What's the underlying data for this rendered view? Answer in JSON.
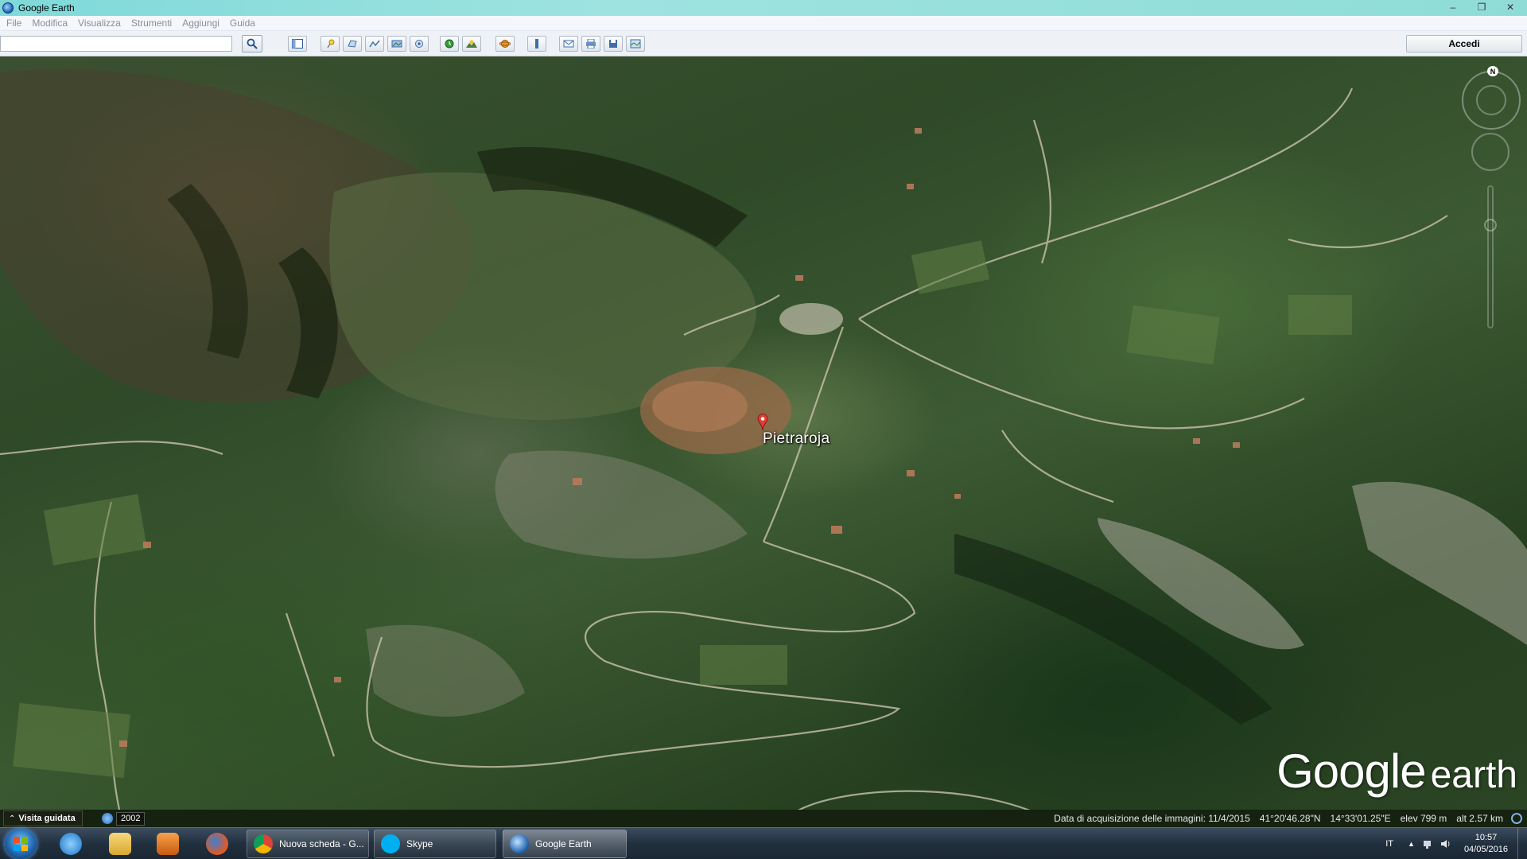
{
  "window": {
    "title": "Google Earth",
    "minimize": "–",
    "restore": "❐",
    "close": "✕"
  },
  "menu": [
    "File",
    "Modifica",
    "Visualizza",
    "Strumenti",
    "Aggiungi",
    "Guida"
  ],
  "toolbar": {
    "search_value": "",
    "search_placeholder": "",
    "accedi_label": "Accedi"
  },
  "map": {
    "place_label": "Pietraroja",
    "compass_n": "N"
  },
  "logo": {
    "google": "Google",
    "earth": "earth"
  },
  "status": {
    "tour_label": "Visita guidata",
    "historical_year": "2002",
    "imagery_date": "Data di acquisizione delle immagini: 11/4/2015",
    "latitude": "41°20'46.28\"N",
    "longitude": "14°33'01.25\"E",
    "elev": "elev   799 m",
    "alt": "alt   2.57 km"
  },
  "taskbar": {
    "tasks": [
      {
        "label": "Nuova scheda - G..."
      },
      {
        "label": "Skype"
      },
      {
        "label": "Google Earth"
      }
    ],
    "lang": "IT",
    "time": "10:57",
    "date": "04/05/2016"
  },
  "colors": {
    "titlebar": "#8fdcd6",
    "map_base": "#2f4a28",
    "pin": "#e53935",
    "taskbar": "#22303f"
  }
}
